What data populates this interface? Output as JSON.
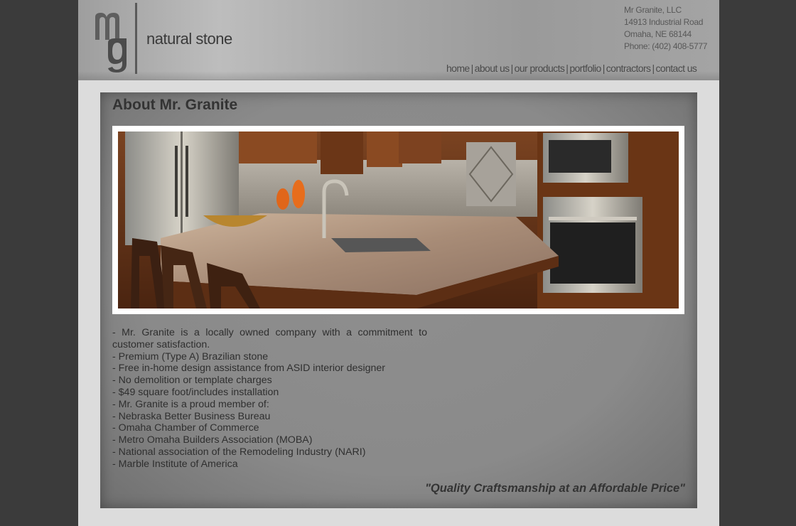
{
  "brand": {
    "logo_text": "natural stone",
    "logo_letters": "mg"
  },
  "company": {
    "name": "Mr Granite, LLC",
    "street": "14913 Industrial Road",
    "city": "Omaha, NE 68144",
    "phone": "Phone: (402) 408-5777"
  },
  "nav": {
    "items": [
      {
        "label": "home"
      },
      {
        "label": "about us"
      },
      {
        "label": "our products"
      },
      {
        "label": "portfolio"
      },
      {
        "label": "contractors"
      },
      {
        "label": "contact us"
      }
    ],
    "separator": "|"
  },
  "main": {
    "title": "About Mr. Granite",
    "photo_alt": "kitchen-with-granite-countertops-photo",
    "lines": [
      "- Mr. Granite is a locally owned company with a commitment to customer satisfaction.",
      "- Premium (Type A) Brazilian stone",
      "- Free in-home design assistance from ASID interior designer",
      "- No demolition or template charges",
      "- $49 square foot/includes installation",
      "- Mr. Granite is a proud member of:",
      "- Nebraska Better Business Bureau",
      "- Omaha Chamber of Commerce",
      "- Metro Omaha Builders Association (MOBA)",
      "- National association of the Remodeling Industry (NARI)",
      "- Marble Institute of America"
    ],
    "tagline": "\"Quality Craftsmanship at an Affordable Price\""
  },
  "colors": {
    "page_background": "#3b3b3b",
    "panel_background": "#dcdcdc",
    "header_gray": "#a8a8a8",
    "content_gray": "#8a8a8a",
    "text_dark": "#333333"
  }
}
